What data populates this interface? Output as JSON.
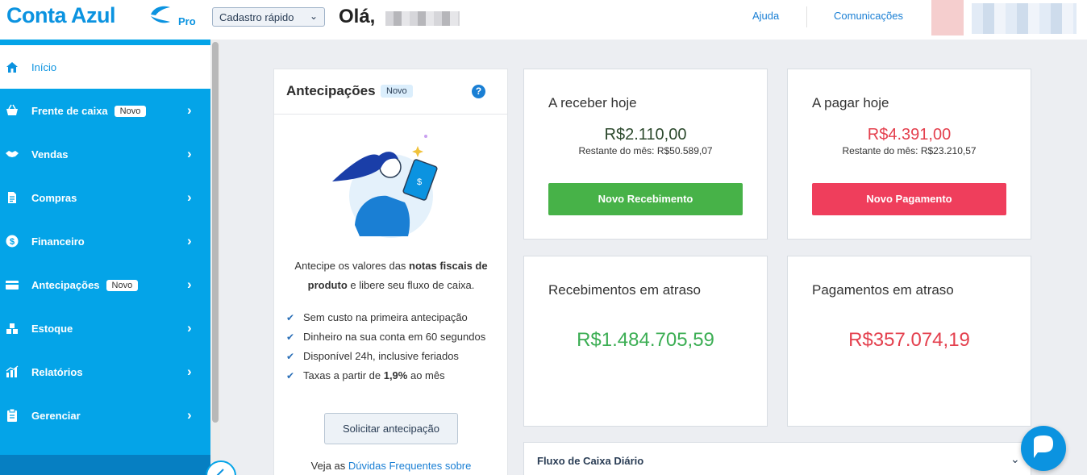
{
  "header": {
    "logo_text": "Conta Azul",
    "logo_plan": "Pro",
    "quick_register_label": "Cadastro rápido",
    "greeting": "Olá,",
    "help_link": "Ajuda",
    "communications_link": "Comunicações"
  },
  "sidebar": {
    "items": [
      {
        "label": "Início",
        "icon": "home-icon",
        "active": true,
        "has_arrow": false
      },
      {
        "label": "Frente de caixa",
        "icon": "basket-icon",
        "badge": "Novo",
        "has_arrow": true
      },
      {
        "label": "Vendas",
        "icon": "handshake-icon",
        "has_arrow": true
      },
      {
        "label": "Compras",
        "icon": "document-icon",
        "has_arrow": true
      },
      {
        "label": "Financeiro",
        "icon": "dollar-coin-icon",
        "has_arrow": true
      },
      {
        "label": "Antecipações",
        "icon": "card-icon",
        "badge": "Novo",
        "has_arrow": true
      },
      {
        "label": "Estoque",
        "icon": "boxes-icon",
        "has_arrow": true
      },
      {
        "label": "Relatórios",
        "icon": "chart-icon",
        "has_arrow": true
      },
      {
        "label": "Gerenciar",
        "icon": "clipboard-icon",
        "has_arrow": true
      }
    ]
  },
  "antecipacoes": {
    "title": "Antecipações",
    "badge": "Novo",
    "desc_part1": "Antecipe os valores das ",
    "desc_bold1": "notas fiscais de produto",
    "desc_part2": " e libere seu fluxo de caixa.",
    "benefits": [
      "Sem custo na primeira antecipação",
      "Dinheiro na sua conta em 60 segundos",
      "Disponível 24h, inclusive feriados"
    ],
    "rate_prefix": "Taxas a partir de ",
    "rate_value": "1,9%",
    "rate_suffix": " ao mês",
    "button_label": "Solicitar antecipação",
    "faq_prefix": "Veja as ",
    "faq_link": "Dúvidas Frequentes sobre"
  },
  "receber_hoje": {
    "title": "A receber hoje",
    "value": "R$2.110,00",
    "remaining": "Restante do mês: R$50.589,07",
    "button_label": "Novo Recebimento"
  },
  "pagar_hoje": {
    "title": "A pagar hoje",
    "value": "R$4.391,00",
    "remaining": "Restante do mês: R$23.210,57",
    "button_label": "Novo Pagamento"
  },
  "recebimentos_atraso": {
    "title": "Recebimentos em atraso",
    "value": "R$1.484.705,59"
  },
  "pagamentos_atraso": {
    "title": "Pagamentos em atraso",
    "value": "R$357.074,19"
  },
  "fluxo": {
    "title": "Fluxo de Caixa Diário"
  },
  "colors": {
    "brand_blue": "#04a4e8",
    "link_blue": "#1a7fd4",
    "green": "#47b248",
    "green_value": "#3cae54",
    "dark_green_value": "#2d4a2e",
    "red": "#ef3e5c",
    "red_value": "#e4404e"
  }
}
